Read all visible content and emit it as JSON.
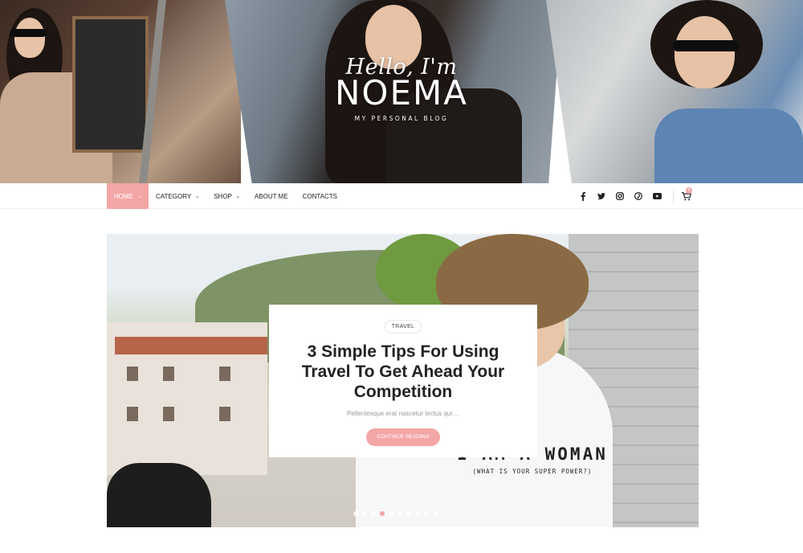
{
  "header": {
    "greeting": "Hello, I'm",
    "brand": "NOEMA",
    "tagline": "MY PERSONAL BLOG"
  },
  "nav": {
    "items": [
      {
        "label": "HOME",
        "has_caret": true,
        "active": true
      },
      {
        "label": "CATEGORY",
        "has_caret": true,
        "active": false
      },
      {
        "label": "SHOP",
        "has_caret": true,
        "active": false
      },
      {
        "label": "ABOUT ME",
        "has_caret": false,
        "active": false
      },
      {
        "label": "CONTACTS",
        "has_caret": false,
        "active": false
      }
    ],
    "caret_glyph": "⌄",
    "social": [
      {
        "name": "facebook-icon",
        "glyph": "f"
      },
      {
        "name": "twitter-icon",
        "glyph": "🐦"
      },
      {
        "name": "instagram-icon",
        "glyph": "◎"
      },
      {
        "name": "pinterest-icon",
        "glyph": "℗"
      },
      {
        "name": "youtube-icon",
        "glyph": "▶"
      }
    ],
    "cart_icon": "cart-icon",
    "cart_count": "0"
  },
  "hero": {
    "shirt_line_1": "I AM A WOMAN",
    "shirt_line_2": "(WHAT IS YOUR SUPER POWER?)",
    "card": {
      "tag": "TRAVEL",
      "title": "3 Simple Tips For Using Travel To Get Ahead Your Competition",
      "excerpt": "Pellentesque erat nascetur lectus qui ...",
      "button": "CONTINUE READING"
    },
    "slider": {
      "count": 10,
      "active_index": 3
    }
  },
  "colors": {
    "accent": "#f4a6a6",
    "text": "#222222",
    "muted": "#9a9a9a"
  }
}
